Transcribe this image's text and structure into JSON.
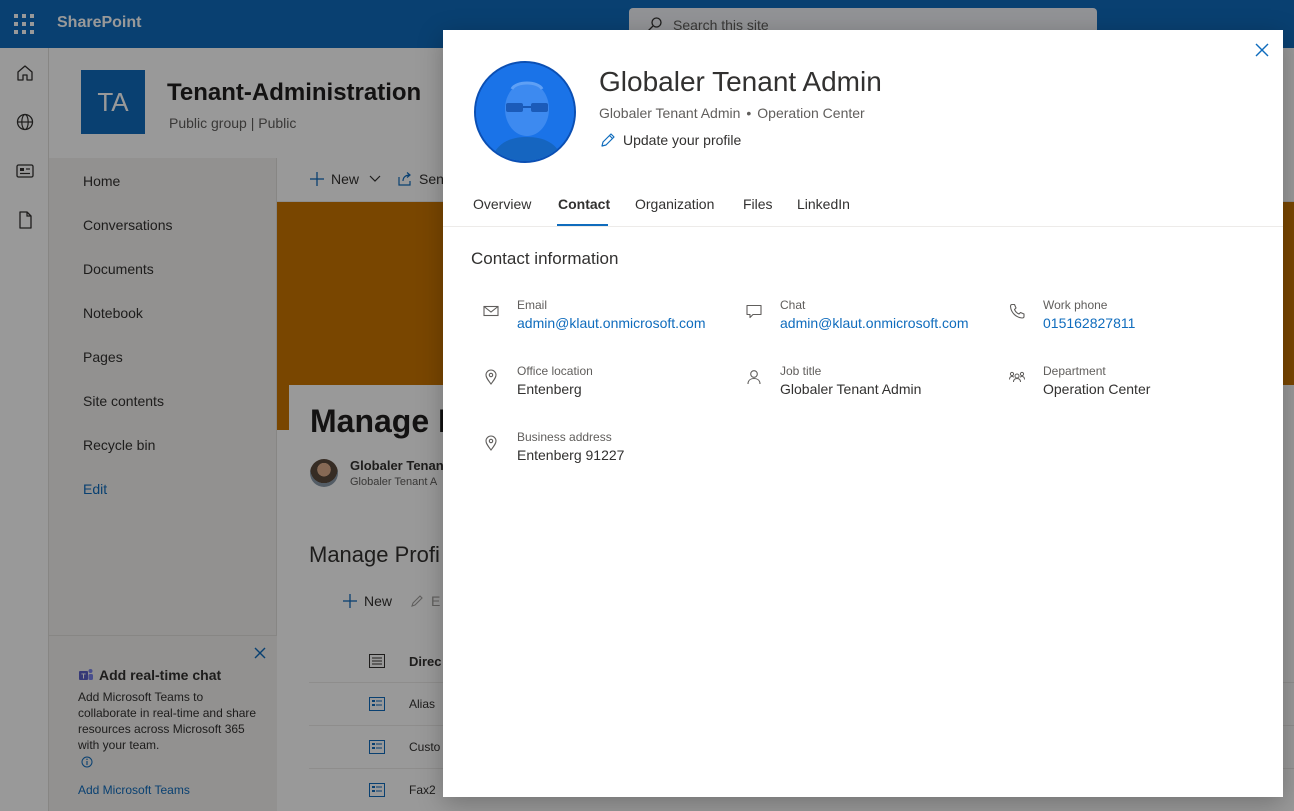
{
  "suite": {
    "brand": "SharePoint",
    "search_placeholder": "Search this site"
  },
  "site": {
    "logo_initials": "TA",
    "title": "Tenant-Administration",
    "subtitle": "Public group | Public"
  },
  "nav": {
    "items": [
      "Home",
      "Conversations",
      "Documents",
      "Notebook",
      "Pages",
      "Site contents",
      "Recycle bin"
    ],
    "edit_label": "Edit"
  },
  "chat_card": {
    "title": "Add real-time chat",
    "body": "Add Microsoft Teams to collaborate in real-time and share resources across Microsoft 365 with your team.",
    "link": "Add Microsoft Teams"
  },
  "commandbar": {
    "new_label": "New",
    "send_label": "Sen"
  },
  "page": {
    "title": "Manage P",
    "author_name": "Globaler Tenan",
    "author_title": "Globaler Tenant A",
    "section_title": "Manage Profi",
    "list_new": "New",
    "list_edit": "E",
    "rows": [
      "Direc",
      "Alias",
      "Custo",
      "Fax2"
    ]
  },
  "profile_card": {
    "name": "Globaler Tenant Admin",
    "job_title": "Globaler Tenant Admin",
    "separator": "•",
    "department": "Operation Center",
    "update_label": "Update your profile",
    "tabs": [
      "Overview",
      "Contact",
      "Organization",
      "Files",
      "LinkedIn"
    ],
    "active_tab": "Contact",
    "section_title": "Contact information",
    "fields": {
      "email": {
        "label": "Email",
        "value": "admin@klaut.onmicrosoft.com"
      },
      "chat": {
        "label": "Chat",
        "value": "admin@klaut.onmicrosoft.com"
      },
      "work_phone": {
        "label": "Work phone",
        "value": "015162827811"
      },
      "office_location": {
        "label": "Office location",
        "value": "Entenberg"
      },
      "job_title": {
        "label": "Job title",
        "value": "Globaler Tenant Admin"
      },
      "department": {
        "label": "Department",
        "value": "Operation Center"
      },
      "business_address": {
        "label": "Business address",
        "value": "Entenberg 91227"
      }
    }
  },
  "colors": {
    "accent": "#0f6cbd",
    "suite_bar": "#0f6cbd",
    "hero": "#ca7600",
    "avatar_tint": "#1a73e8"
  }
}
